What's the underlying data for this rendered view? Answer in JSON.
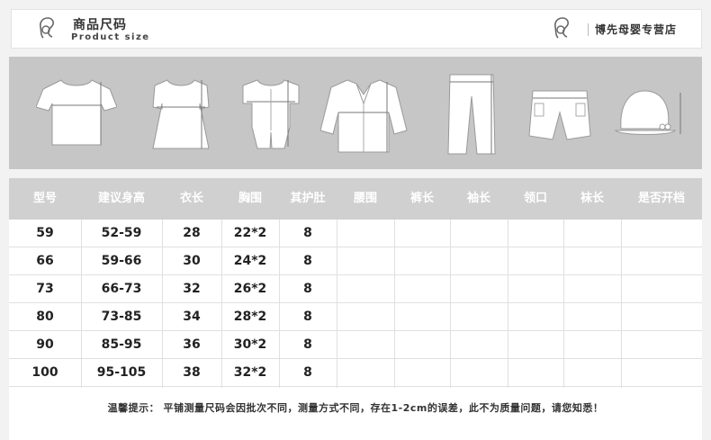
{
  "header": {
    "title_cn": "商品尺码",
    "title_en": "Product size",
    "store_name": "博先母婴专营店",
    "logo_icon": "mother-baby-icon"
  },
  "banner": {
    "icons": [
      "tshirt-icon",
      "dress-icon",
      "romper-icon",
      "jacket-icon",
      "pants-icon",
      "shorts-icon",
      "hat-icon"
    ]
  },
  "table": {
    "headers": [
      "型号",
      "建议身高",
      "衣长",
      "胸围",
      "其护肚",
      "腰围",
      "裤长",
      "袖长",
      "领口",
      "袜长",
      "是否开档"
    ],
    "rows": [
      [
        "59",
        "52-59",
        "28",
        "22*2",
        "8",
        "",
        "",
        "",
        "",
        "",
        ""
      ],
      [
        "66",
        "59-66",
        "30",
        "24*2",
        "8",
        "",
        "",
        "",
        "",
        "",
        ""
      ],
      [
        "73",
        "66-73",
        "32",
        "26*2",
        "8",
        "",
        "",
        "",
        "",
        "",
        ""
      ],
      [
        "80",
        "73-85",
        "34",
        "28*2",
        "8",
        "",
        "",
        "",
        "",
        "",
        ""
      ],
      [
        "90",
        "85-95",
        "36",
        "30*2",
        "8",
        "",
        "",
        "",
        "",
        "",
        ""
      ],
      [
        "100",
        "95-105",
        "38",
        "32*2",
        "8",
        "",
        "",
        "",
        "",
        "",
        ""
      ]
    ]
  },
  "note": "温馨提示： 平铺测量尺码会因批次不同，测量方式不同，存在1-2cm的误差，此不为质量问题，请您知悉！",
  "colors": {
    "banner_bg": "#c6c6c6",
    "header_row_bg": "#d0d0d0"
  }
}
